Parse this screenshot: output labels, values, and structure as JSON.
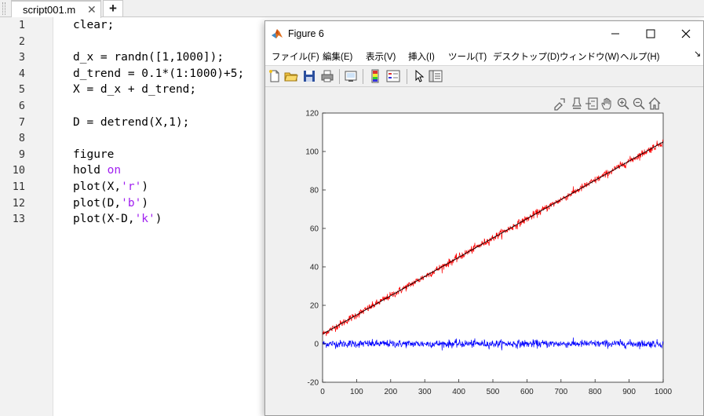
{
  "editor": {
    "tab_label": "script001.m",
    "tab_close": "✕",
    "add_tab": "+",
    "lines": [
      {
        "num": "1",
        "code": "clear;"
      },
      {
        "num": "2",
        "code": ""
      },
      {
        "num": "3",
        "code": "d_x = randn([1,1000]);"
      },
      {
        "num": "4",
        "code": "d_trend = 0.1*(1:1000)+5;"
      },
      {
        "num": "5",
        "code": "X = d_x + d_trend;"
      },
      {
        "num": "6",
        "code": ""
      },
      {
        "num": "7",
        "code": "D = detrend(X,1);"
      },
      {
        "num": "8",
        "code": ""
      },
      {
        "num": "9",
        "code": "figure"
      },
      {
        "num": "10",
        "code_pre": "hold ",
        "kw": "on"
      },
      {
        "num": "11",
        "code_pre": "plot(X,",
        "kw": "'r'",
        "code_post": ")"
      },
      {
        "num": "12",
        "code_pre": "plot(D,",
        "kw": "'b'",
        "code_post": ")"
      },
      {
        "num": "13",
        "code_pre": "plot(X-D,",
        "kw": "'k'",
        "code_post": ")"
      }
    ]
  },
  "figure": {
    "title": "Figure 6",
    "menus": [
      "ファイル(F)",
      "編集(E)",
      "表示(V)",
      "挿入(I)",
      "ツール(T)",
      "デスクトップ(D)",
      "ウィンドウ(W)",
      "ヘルプ(H)"
    ],
    "menu_more": "↘",
    "toolbar_icons": [
      "new-figure-icon",
      "open-file-icon",
      "save-icon",
      "print-icon",
      "link-plot-icon",
      "colorbar-icon",
      "legend-icon",
      "pointer-icon",
      "property-inspector-icon"
    ],
    "axes_toolbar_icons": [
      "export-icon",
      "brush-icon",
      "data-tips-icon",
      "pan-icon",
      "zoom-in-icon",
      "zoom-out-icon",
      "home-icon"
    ],
    "colors": {
      "red": "#ff0000",
      "blue": "#0000ff",
      "black": "#000000"
    }
  },
  "chart_data": {
    "type": "line",
    "xlim": [
      0,
      1000
    ],
    "ylim": [
      -20,
      120
    ],
    "xticks": [
      0,
      100,
      200,
      300,
      400,
      500,
      600,
      700,
      800,
      900,
      1000
    ],
    "yticks": [
      -20,
      0,
      20,
      40,
      60,
      80,
      100,
      120
    ],
    "grid": false,
    "series": [
      {
        "color": "#ff0000",
        "trend": {
          "slope": 0.1,
          "intercept": 5
        },
        "noise_std": 1
      },
      {
        "color": "#0000ff",
        "trend": {
          "slope": 0,
          "intercept": 0
        },
        "noise_std": 1
      },
      {
        "color": "#000000",
        "trend": {
          "slope": 0.1,
          "intercept": 5
        },
        "noise_std": 0
      }
    ]
  }
}
